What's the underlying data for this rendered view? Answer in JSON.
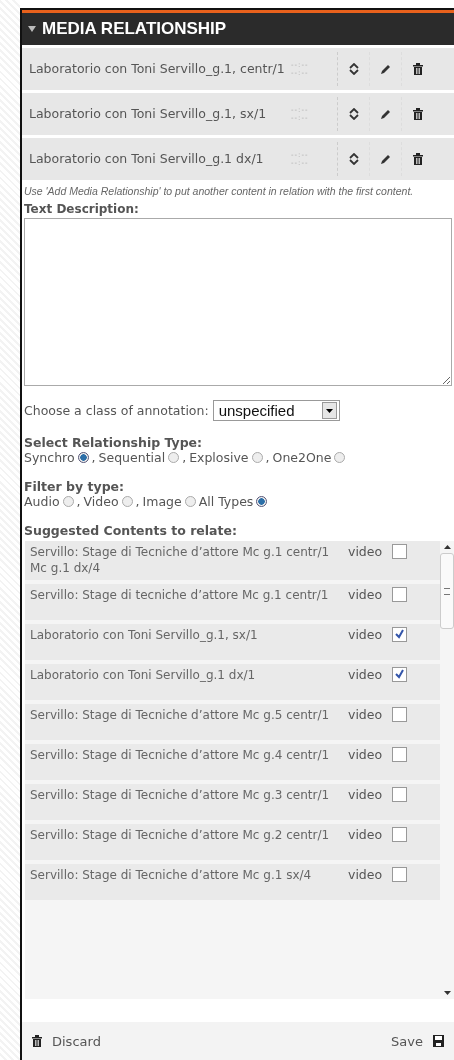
{
  "panel": {
    "title": "MEDIA RELATIONSHIP",
    "expanded": true
  },
  "relations": [
    {
      "title": "Laboratorio con Toni Servillo_g.1, centr/1",
      "time_start": "--:--",
      "time_end": "--:--"
    },
    {
      "title": "Laboratorio con Toni Servillo_g.1, sx/1",
      "time_start": "--:--",
      "time_end": "--:--"
    },
    {
      "title": "Laboratorio con Toni Servillo_g.1 dx/1",
      "time_start": "--:--",
      "time_end": "--:--"
    }
  ],
  "hint": "Use 'Add Media Relationship' to put another content in relation with the first content.",
  "text_description": {
    "label": "Text Description:"
  },
  "annotation": {
    "label": "Choose a class of annotation:",
    "value": "unspecified"
  },
  "relationship_type": {
    "label": "Select Relationship Type:",
    "options": [
      {
        "label": "Synchro",
        "suffix": ",",
        "selected": true
      },
      {
        "label": "Sequential",
        "suffix": ",",
        "selected": false
      },
      {
        "label": "Explosive",
        "suffix": ",",
        "selected": false
      },
      {
        "label": "One2One",
        "selected": false
      }
    ]
  },
  "filter": {
    "label": "Filter by type:",
    "options": [
      {
        "label": "Audio",
        "suffix": ",",
        "selected": false
      },
      {
        "label": "Video",
        "suffix": ",",
        "selected": false
      },
      {
        "label": "Image",
        "selected": false
      },
      {
        "label": "All Types",
        "selected": true
      }
    ]
  },
  "suggested": {
    "label": "Suggested Contents to relate:",
    "items": [
      {
        "title": "Servillo: Stage di Tecniche d’attore Mc g.1 centr/1 Mc g.1 dx/4",
        "type": "video",
        "checked": false
      },
      {
        "title": "Servillo: Stage di tecniche d’attore Mc g.1 centr/1",
        "type": "video",
        "checked": false
      },
      {
        "title": "Laboratorio con Toni Servillo_g.1, sx/1",
        "type": "video",
        "checked": true
      },
      {
        "title": "Laboratorio con Toni Servillo_g.1 dx/1",
        "type": "video",
        "checked": true
      },
      {
        "title": "Servillo: Stage di Tecniche d’attore Mc g.5 centr/1",
        "type": "video",
        "checked": false
      },
      {
        "title": "Servillo: Stage di Tecniche d’attore Mc g.4 centr/1",
        "type": "video",
        "checked": false
      },
      {
        "title": "Servillo: Stage di Tecniche d’attore Mc g.3 centr/1",
        "type": "video",
        "checked": false
      },
      {
        "title": "Servillo: Stage di Tecniche d’attore Mc g.2 centr/1",
        "type": "video",
        "checked": false
      },
      {
        "title": "Servillo: Stage di Tecniche d’attore Mc g.1 sx/4",
        "type": "video",
        "checked": false
      }
    ]
  },
  "footer": {
    "discard": "Discard",
    "save": "Save"
  }
}
